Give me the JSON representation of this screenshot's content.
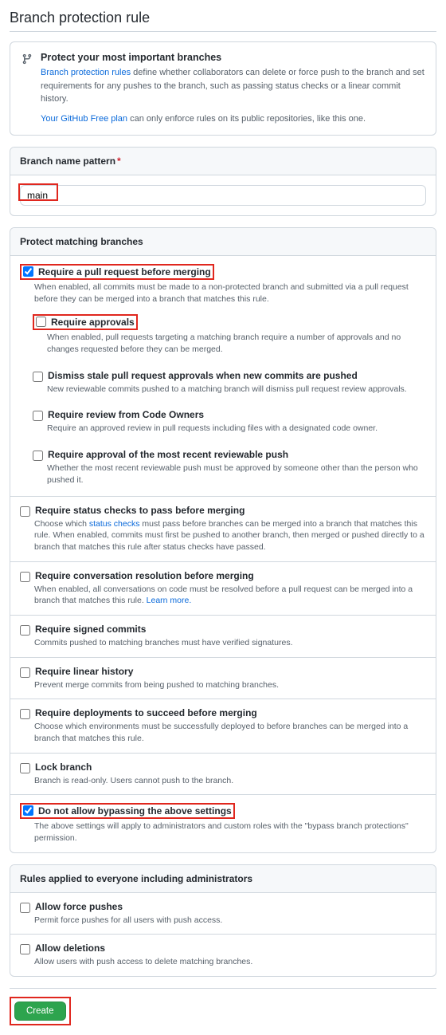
{
  "title": "Branch protection rule",
  "intro": {
    "heading": "Protect your most important branches",
    "line1_link": "Branch protection rules",
    "line1_rest": " define whether collaborators can delete or force push to the branch and set requirements for any pushes to the branch, such as passing status checks or a linear commit history.",
    "line2_link": "Your GitHub Free plan",
    "line2_rest": " can only enforce rules on its public repositories, like this one."
  },
  "pattern": {
    "header": "Branch name pattern",
    "value": "main"
  },
  "protect_header": "Protect matching branches",
  "rules": {
    "require_pr": {
      "label": "Require a pull request before merging",
      "desc": "When enabled, all commits must be made to a non-protected branch and submitted via a pull request before they can be merged into a branch that matches this rule."
    },
    "require_approvals": {
      "label": "Require approvals",
      "desc": "When enabled, pull requests targeting a matching branch require a number of approvals and no changes requested before they can be merged."
    },
    "dismiss_stale": {
      "label": "Dismiss stale pull request approvals when new commits are pushed",
      "desc": "New reviewable commits pushed to a matching branch will dismiss pull request review approvals."
    },
    "code_owners": {
      "label": "Require review from Code Owners",
      "desc": "Require an approved review in pull requests including files with a designated code owner."
    },
    "recent_push": {
      "label": "Require approval of the most recent reviewable push",
      "desc": "Whether the most recent reviewable push must be approved by someone other than the person who pushed it."
    },
    "status_checks": {
      "label": "Require status checks to pass before merging",
      "desc_pre": "Choose which ",
      "desc_link": "status checks",
      "desc_post": " must pass before branches can be merged into a branch that matches this rule. When enabled, commits must first be pushed to another branch, then merged or pushed directly to a branch that matches this rule after status checks have passed."
    },
    "conversation": {
      "label": "Require conversation resolution before merging",
      "desc": "When enabled, all conversations on code must be resolved before a pull request can be merged into a branch that matches this rule. ",
      "learn": "Learn more."
    },
    "signed": {
      "label": "Require signed commits",
      "desc": "Commits pushed to matching branches must have verified signatures."
    },
    "linear": {
      "label": "Require linear history",
      "desc": "Prevent merge commits from being pushed to matching branches."
    },
    "deployments": {
      "label": "Require deployments to succeed before merging",
      "desc": "Choose which environments must be successfully deployed to before branches can be merged into a branch that matches this rule."
    },
    "lock": {
      "label": "Lock branch",
      "desc": "Branch is read-only. Users cannot push to the branch."
    },
    "no_bypass": {
      "label": "Do not allow bypassing the above settings",
      "desc": "The above settings will apply to administrators and custom roles with the \"bypass branch protections\" permission."
    }
  },
  "admin_header": "Rules applied to everyone including administrators",
  "admin_rules": {
    "force_pushes": {
      "label": "Allow force pushes",
      "desc": "Permit force pushes for all users with push access."
    },
    "deletions": {
      "label": "Allow deletions",
      "desc": "Allow users with push access to delete matching branches."
    }
  },
  "create_btn": "Create"
}
